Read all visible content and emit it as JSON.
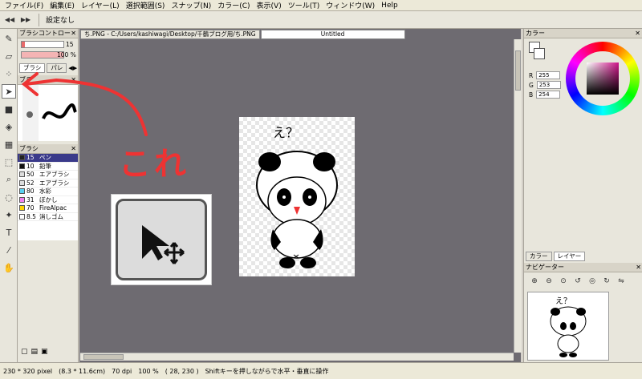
{
  "menu": [
    "ファイル(F)",
    "編集(E)",
    "レイヤー(L)",
    "選択範囲(S)",
    "スナップ(N)",
    "カラー(C)",
    "表示(V)",
    "ツール(T)",
    "ウィンドウ(W)",
    "Help"
  ],
  "toolbar": {
    "prev_icon": "◀◀",
    "next_icon": "▶▶",
    "settings_label": "設定なし"
  },
  "brush_control": {
    "title": "ブラシコントロー",
    "size_value": "15",
    "opacity_value": "100 %",
    "tab_brush": "ブラシ",
    "tab_palette": "パレ"
  },
  "brush_preview": {
    "title": "ブラ"
  },
  "brush_list": {
    "title": "ブラシ",
    "items": [
      {
        "size": "15",
        "name": "ペン",
        "color": "#222222",
        "selected": true
      },
      {
        "size": "10",
        "name": "鉛筆",
        "color": "#111111",
        "selected": false
      },
      {
        "size": "50",
        "name": "エアブラシ",
        "color": "#dddddd",
        "selected": false
      },
      {
        "size": "52",
        "name": "エアブラシ",
        "color": "#dddddd",
        "selected": false
      },
      {
        "size": "80",
        "name": "水彩",
        "color": "#59d0f0",
        "selected": false
      },
      {
        "size": "31",
        "name": "ぼかし",
        "color": "#f080f0",
        "selected": false
      },
      {
        "size": "70",
        "name": "FireAlpac",
        "color": "#ffd400",
        "selected": false
      },
      {
        "size": "8.5",
        "name": "消しゴム",
        "color": "#ffffff",
        "selected": false
      }
    ]
  },
  "tabs": {
    "file_tab": "ち.PNG - C:/Users/kashiwagi/Desktop/千鶴ブログ用/ち.PNG",
    "untitled_tab": "Untitled"
  },
  "annotation": {
    "text": "これ"
  },
  "color_panel": {
    "title": "カラー",
    "r_label": "R",
    "r_value": "255",
    "g_label": "G",
    "g_value": "253",
    "b_label": "B",
    "b_value": "254"
  },
  "layer_tabs": {
    "color_tab": "カラー",
    "layer_tab": "レイヤー"
  },
  "navigator": {
    "title": "ナビゲーター"
  },
  "drawing": {
    "text": "え？"
  },
  "statusbar": {
    "size": "230 * 320 pixel",
    "physical": "(8.3 * 11.6cm)",
    "dpi": "70 dpi",
    "zoom": "100 %",
    "cursor": "( 28, 230 )",
    "hint": "Shiftキーを押しながらで水平・垂直に操作"
  }
}
